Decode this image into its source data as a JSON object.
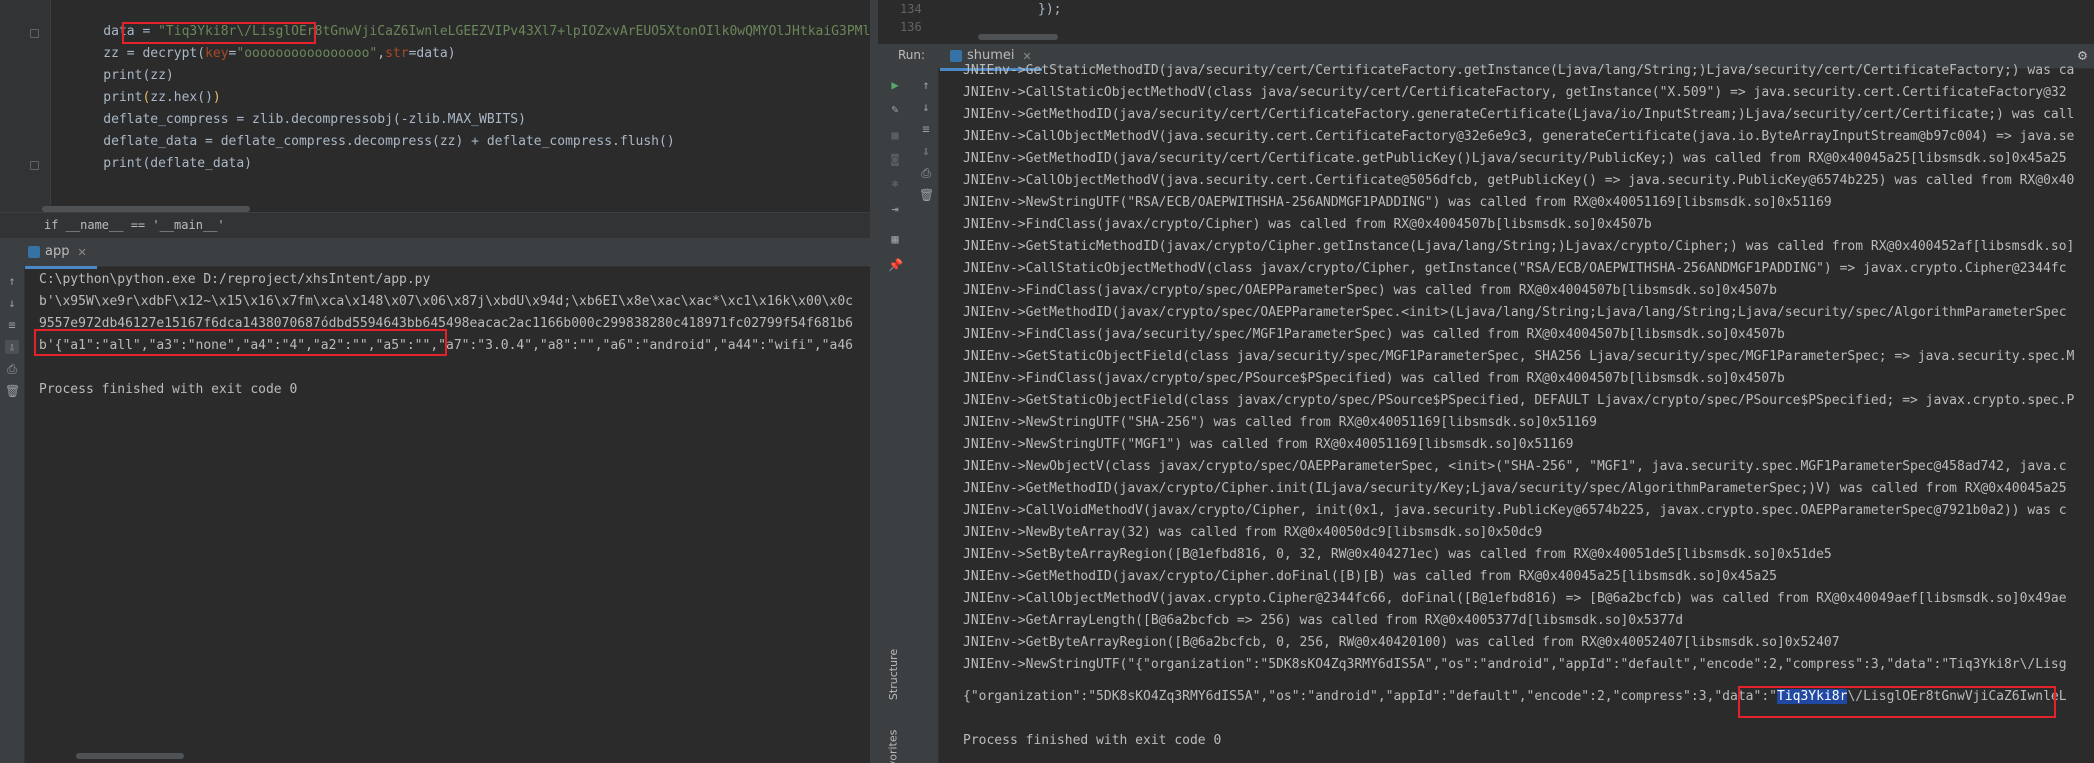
{
  "editor": {
    "lines": [
      {
        "parts": [
          [
            "",
            "    data = "
          ],
          [
            "str",
            "\"Tiq3Yki8r\\/LisglOEr8tGnwVjiCaZ6IwnleLGEEZVIPv43Xl7+lpIOZxvArEUO5XtonOIlk0wQMYOlJHtkaiG3PMlgF"
          ]
        ]
      },
      {
        "parts": [
          [
            "",
            "    zz = decrypt("
          ],
          [
            "param",
            "key"
          ],
          [
            "",
            "="
          ],
          [
            "str",
            "\"oooooooooooooooo\""
          ],
          [
            "",
            ","
          ],
          [
            "param",
            "str"
          ],
          [
            "",
            "=data)"
          ]
        ]
      },
      {
        "parts": [
          [
            "",
            "    print(zz)"
          ]
        ]
      },
      {
        "parts": [
          [
            "",
            "    print"
          ],
          [
            "paren",
            "("
          ],
          [
            "",
            "zz.hex()"
          ],
          [
            "paren",
            ")"
          ]
        ]
      },
      {
        "parts": [
          [
            "",
            "    deflate_compress = zlib.decompressobj(-zlib.MAX_WBITS)"
          ]
        ]
      },
      {
        "parts": [
          [
            "",
            "    deflate_data = deflate_compress.decompress(zz) + deflate_compress.flush()"
          ]
        ]
      },
      {
        "parts": [
          [
            "",
            "    print(deflate_data)"
          ]
        ]
      }
    ],
    "breadcrumb": "if __name__ == '__main__'"
  },
  "left_run": {
    "tab": "app",
    "output": [
      "C:\\python\\python.exe D:/reproject/xhsIntent/app.py",
      "b'\\x95W\\xe9r\\xdbF\\x12~\\x15\\x16\\x7fm\\xca\\x148\\x07\\x06\\x87j\\xbdU\\x94d;\\xb6EI\\x8e\\xac\\xac*\\xc1\\x16k\\x00\\x0c",
      "9557e972db46127e15167f6dca1438070687ódbd5594643bb645498eacac2ac1166b000c299838280c418971fc02799f54f681b6",
      "b'{\"a1\":\"all\",\"a3\":\"none\",\"a4\":\"4\",\"a2\":\"\",\"a5\":\"\",\"a7\":\"3.0.4\",\"a8\":\"\",\"a6\":\"android\",\"a44\":\"wifi\",\"a46",
      "",
      "Process finished with exit code 0"
    ]
  },
  "right_editor": {
    "line_numbers": [
      "134",
      "136"
    ],
    "code": "});"
  },
  "right_run": {
    "run_label": "Run:",
    "tab": "shumei",
    "side_labels": [
      "Structure",
      "Favorites"
    ],
    "log_pre": "{\"organization\":\"5DK8sKO4Zq3RMY6dIS5A\",\"os\":\"android\",\"appId\":\"default\",\"encode\":2,\"compress\":3,\"data\":\"",
    "log_sel": "Tiq3Yki8r",
    "log_post": "\\/LisglOEr8tGnwVjiCaZ6IwnleL",
    "logs": [
      "JNIEnv->GetStaticMethodID(java/security/cert/CertificateFactory.getInstance(Ljava/lang/String;)Ljava/security/cert/CertificateFactory;) was ca",
      "JNIEnv->CallStaticObjectMethodV(class java/security/cert/CertificateFactory, getInstance(\"X.509\") => java.security.cert.CertificateFactory@32",
      "JNIEnv->GetMethodID(java/security/cert/CertificateFactory.generateCertificate(Ljava/io/InputStream;)Ljava/security/cert/Certificate;) was call",
      "JNIEnv->CallObjectMethodV(java.security.cert.CertificateFactory@32e6e9c3, generateCertificate(java.io.ByteArrayInputStream@b97c004) => java.se",
      "JNIEnv->GetMethodID(java/security/cert/Certificate.getPublicKey()Ljava/security/PublicKey;) was called from RX@0x40045a25[libsmsdk.so]0x45a25",
      "JNIEnv->CallObjectMethodV(java.security.cert.Certificate@5056dfcb, getPublicKey() => java.security.PublicKey@6574b225) was called from RX@0x40",
      "JNIEnv->NewStringUTF(\"RSA/ECB/OAEPWITHSHA-256ANDMGF1PADDING\") was called from RX@0x40051169[libsmsdk.so]0x51169",
      "JNIEnv->FindClass(javax/crypto/Cipher) was called from RX@0x4004507b[libsmsdk.so]0x4507b",
      "JNIEnv->GetStaticMethodID(javax/crypto/Cipher.getInstance(Ljava/lang/String;)Ljavax/crypto/Cipher;) was called from RX@0x400452af[libsmsdk.so]",
      "JNIEnv->CallStaticObjectMethodV(class javax/crypto/Cipher, getInstance(\"RSA/ECB/OAEPWITHSHA-256ANDMGF1PADDING\") => javax.crypto.Cipher@2344fc",
      "JNIEnv->FindClass(javax/crypto/spec/OAEPParameterSpec) was called from RX@0x4004507b[libsmsdk.so]0x4507b",
      "JNIEnv->GetMethodID(javax/crypto/spec/OAEPParameterSpec.<init>(Ljava/lang/String;Ljava/lang/String;Ljava/security/spec/AlgorithmParameterSpec",
      "JNIEnv->FindClass(java/security/spec/MGF1ParameterSpec) was called from RX@0x4004507b[libsmsdk.so]0x4507b",
      "JNIEnv->GetStaticObjectField(class java/security/spec/MGF1ParameterSpec, SHA256 Ljava/security/spec/MGF1ParameterSpec; => java.security.spec.M",
      "JNIEnv->FindClass(javax/crypto/spec/PSource$PSpecified) was called from RX@0x4004507b[libsmsdk.so]0x4507b",
      "JNIEnv->GetStaticObjectField(class javax/crypto/spec/PSource$PSpecified, DEFAULT Ljavax/crypto/spec/PSource$PSpecified; => javax.crypto.spec.P",
      "JNIEnv->NewStringUTF(\"SHA-256\") was called from RX@0x40051169[libsmsdk.so]0x51169",
      "JNIEnv->NewStringUTF(\"MGF1\") was called from RX@0x40051169[libsmsdk.so]0x51169",
      "JNIEnv->NewObjectV(class javax/crypto/spec/OAEPParameterSpec, <init>(\"SHA-256\", \"MGF1\", java.security.spec.MGF1ParameterSpec@458ad742, java.c",
      "JNIEnv->GetMethodID(javax/crypto/Cipher.init(ILjava/security/Key;Ljava/security/spec/AlgorithmParameterSpec;)V) was called from RX@0x40045a25",
      "JNIEnv->CallVoidMethodV(javax/crypto/Cipher, init(0x1, java.security.PublicKey@6574b225, javax.crypto.spec.OAEPParameterSpec@7921b0a2)) was c",
      "JNIEnv->NewByteArray(32) was called from RX@0x40050dc9[libsmsdk.so]0x50dc9",
      "JNIEnv->SetByteArrayRegion([B@1efbd816, 0, 32, RW@0x404271ec) was called from RX@0x40051de5[libsmsdk.so]0x51de5",
      "JNIEnv->GetMethodID(javax/crypto/Cipher.doFinal([B)[B) was called from RX@0x40045a25[libsmsdk.so]0x45a25",
      "JNIEnv->CallObjectMethodV(javax.crypto.Cipher@2344fc66, doFinal([B@1efbd816) => [B@6a2bcfcb) was called from RX@0x40049aef[libsmsdk.so]0x49ae",
      "JNIEnv->GetArrayLength([B@6a2bcfcb => 256) was called from RX@0x4005377d[libsmsdk.so]0x5377d",
      "JNIEnv->GetByteArrayRegion([B@6a2bcfcb, 0, 256, RW@0x40420100) was called from RX@0x40052407[libsmsdk.so]0x52407",
      "JNIEnv->NewStringUTF(\"{\"organization\":\"5DK8sKO4Zq3RMY6dIS5A\",\"os\":\"android\",\"appId\":\"default\",\"encode\":2,\"compress\":3,\"data\":\"Tiq3Yki8r\\/Lisg"
    ],
    "finish": "Process finished with exit code 0"
  }
}
